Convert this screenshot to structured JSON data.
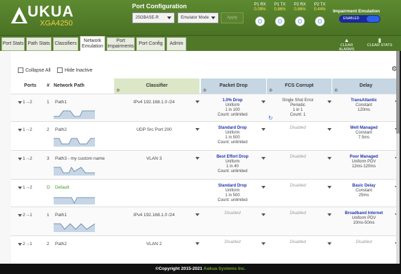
{
  "brand": {
    "name": "UKUA",
    "model": "XGA4250"
  },
  "port_config": {
    "title": "Port Configuration",
    "speed": "25GBASE-R",
    "mode": "Emulator Mode",
    "apply_label": "Apply"
  },
  "stats": [
    {
      "label": "P1 RX",
      "pct": "0.09%"
    },
    {
      "label": "P1 TX",
      "pct": "0.86%"
    },
    {
      "label": "P2 RX",
      "pct": "0.86%"
    },
    {
      "label": "P2 TX",
      "pct": "0.44%"
    }
  ],
  "impairment": {
    "label": "Impairment Emulation",
    "state": "ENABLED"
  },
  "tabs": [
    {
      "label": "Port Stats"
    },
    {
      "label": "Path Stats"
    },
    {
      "label": "Classifiers"
    },
    {
      "label": "Network Emulation"
    },
    {
      "label": "Port Impairments"
    },
    {
      "label": "Port Config"
    },
    {
      "label": "Admin"
    }
  ],
  "actions": {
    "clear_alarms": "CLEAR ALARMS",
    "clear_stats": "CLEAR STATS"
  },
  "controls": {
    "collapse_all": "Collapse All",
    "hide_inactive": "Hide Inactive"
  },
  "columns": {
    "ports": "Ports",
    "num": "#",
    "path": "Network Path",
    "classifier": "Classifier",
    "drop": "Packet Drop",
    "fcs": "FCS Corrupt",
    "delay": "Delay"
  },
  "rows": [
    {
      "ports": "1→2",
      "num": "1",
      "path": "Path1",
      "classifier": "IPv4 192.168.1.0 /24",
      "drop": [
        "1.0% Drop",
        "Uniform",
        "1 in 100",
        "Count: unlimited"
      ],
      "fcs": [
        "Single Shot Error",
        "Periodic",
        "1 in 1",
        "Count: 1"
      ],
      "delay": [
        "TransAtlantic",
        "Constant",
        "120ms"
      ]
    },
    {
      "ports": "1→2",
      "num": "2",
      "path": "Path2",
      "classifier": "UDP Src Port 200",
      "drop": [
        "Standard Drop",
        "Uniform",
        "1 in 500",
        "Count: unlimited"
      ],
      "fcs": [
        "Disabled"
      ],
      "delay": [
        "Well Managed",
        "Constant",
        "7.5ms"
      ]
    },
    {
      "ports": "1→2",
      "num": "3",
      "path": "Path3 - my custom name",
      "classifier": "VLAN 3",
      "drop": [
        "Best Effort Drop",
        "Uniform",
        "1 in 40",
        "Count: unlimited"
      ],
      "fcs": [
        "Disabled"
      ],
      "delay": [
        "Poor Managed",
        "Uniform PDV",
        "12ms-120ms"
      ]
    },
    {
      "ports": "1→2",
      "num": "D",
      "path": "Default",
      "classifier": "",
      "drop": [
        "Standard Drop",
        "Uniform",
        "1 in 500",
        "Count: unlimited"
      ],
      "fcs": [
        "Disabled"
      ],
      "delay": [
        "Basic Delay",
        "Constant",
        "25ms"
      ]
    },
    {
      "ports": "2→1",
      "num": "1",
      "path": "Path1",
      "classifier": "IPv4 192.168.1.0 /24",
      "drop": [
        "Disabled"
      ],
      "fcs": [
        "Disabled"
      ],
      "delay": [
        "Broadband Internet",
        "Uniform PDV",
        "10ms-50ms"
      ]
    },
    {
      "ports": "2→1",
      "num": "2",
      "path": "Path2",
      "classifier": "VLAN 2",
      "drop": [
        "Disabled"
      ],
      "fcs": [
        "Disabled"
      ],
      "delay": [
        "Disabled"
      ]
    }
  ],
  "footer": {
    "copyright": "©Copyright 2015-2021 ",
    "company": "Aukua Systems Inc."
  }
}
